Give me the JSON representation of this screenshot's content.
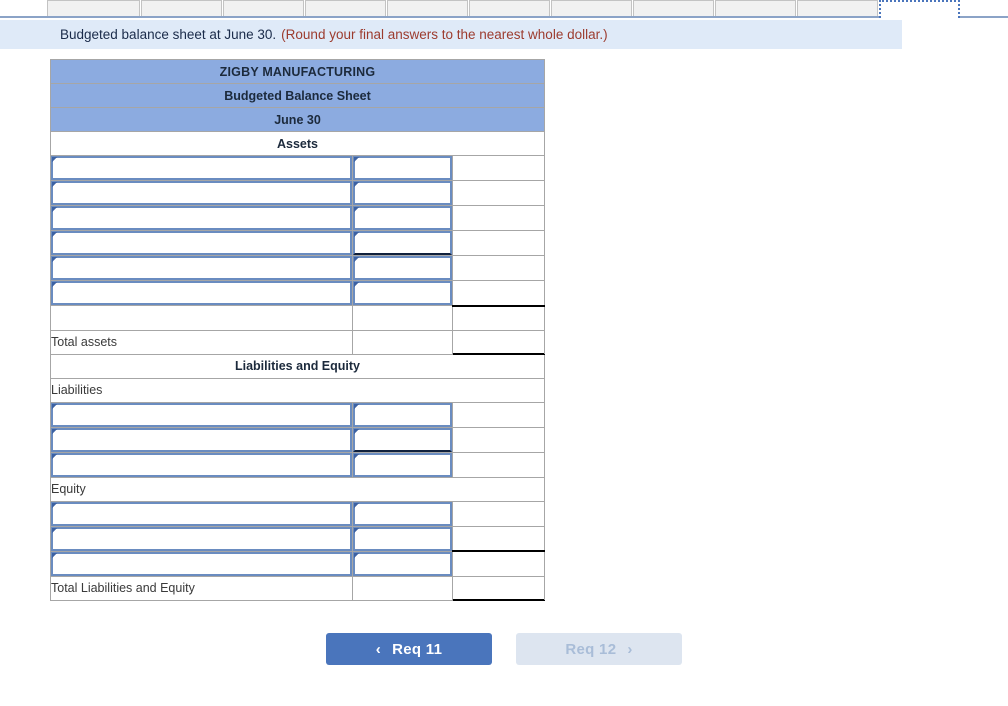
{
  "tabs": {
    "inactive_count": 10,
    "active_index": 10,
    "items": [
      {
        "label": ""
      },
      {
        "label": ""
      },
      {
        "label": ""
      },
      {
        "label": ""
      },
      {
        "label": ""
      },
      {
        "label": ""
      },
      {
        "label": ""
      },
      {
        "label": ""
      },
      {
        "label": ""
      },
      {
        "label": ""
      },
      {
        "label": ""
      }
    ]
  },
  "banner": {
    "main_text": "Budgeted balance sheet at June 30.",
    "note_text": "(Round your final answers to the nearest whole dollar.)",
    "background": "#dfeaf8",
    "note_color": "#9c3b2e"
  },
  "sheet": {
    "company": "ZIGBY MANUFACTURING",
    "statement": "Budgeted Balance Sheet",
    "date": "June 30",
    "assets_heading": "Assets",
    "liab_equity_heading": "Liabilities and Equity",
    "liabilities_heading": "Liabilities",
    "equity_heading": "Equity",
    "total_assets_label": "Total assets",
    "total_liab_equity_label": "Total Liabilities and Equity",
    "header_color": "#8cabe0",
    "field_border_color": "#6a8cc0",
    "asset_rows": [
      {
        "name": "",
        "amount": ""
      },
      {
        "name": "",
        "amount": ""
      },
      {
        "name": "",
        "amount": ""
      },
      {
        "name": "",
        "amount": ""
      },
      {
        "name": "",
        "amount": ""
      },
      {
        "name": "",
        "amount": ""
      }
    ],
    "liability_rows": [
      {
        "name": "",
        "amount": ""
      },
      {
        "name": "",
        "amount": ""
      },
      {
        "name": "",
        "amount": ""
      }
    ],
    "equity_rows": [
      {
        "name": "",
        "amount": ""
      },
      {
        "name": "",
        "amount": ""
      },
      {
        "name": "",
        "amount": ""
      }
    ],
    "total_assets_value": "",
    "total_liab_equity_value": ""
  },
  "nav": {
    "prev_label": "Req 11",
    "next_label": "Req 12",
    "prev_chevron": "‹",
    "next_chevron": "›",
    "prev_color": "#4a75bc",
    "next_color": "#dde5f0",
    "next_disabled": true
  }
}
